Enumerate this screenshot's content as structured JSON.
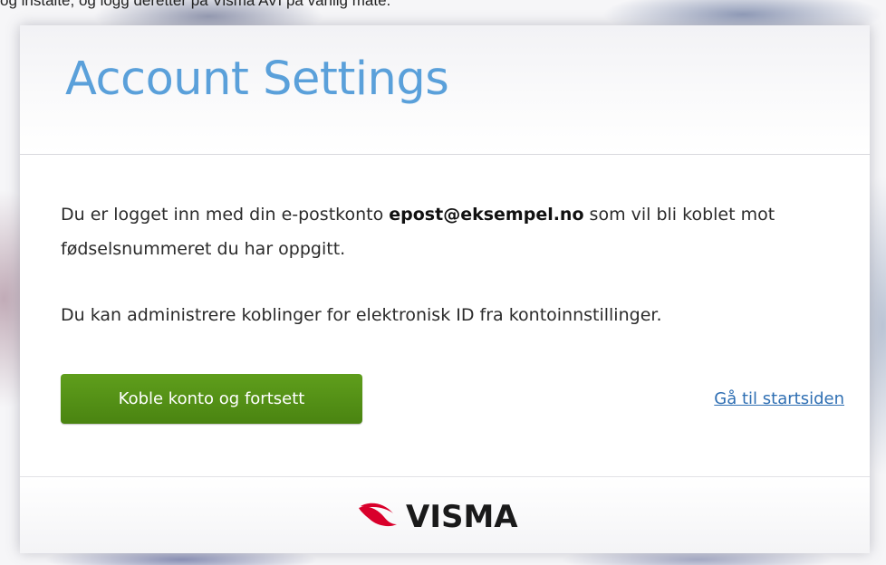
{
  "top_text": "og instalte, og logg deretter på Visma AVI på vanlig måte.",
  "card": {
    "title": "Account Settings",
    "body": {
      "line1_prefix": "Du er logget inn med din e-postkonto ",
      "email": "epost@eksempel.no",
      "line1_suffix": " som vil bli koblet mot fødselsnummeret du har oppgitt.",
      "line2": "Du kan administrere koblinger for elektronisk ID fra kontoinnstillinger."
    },
    "primary_button_label": "Koble konto og fortsett",
    "home_link_label": "Gå til startsiden",
    "footer": {
      "logo_text": "VISMA",
      "logo_color": "#d9002b"
    }
  },
  "colors": {
    "title": "#5aa0da",
    "button": "#4f8a14",
    "link": "#2f6fb3"
  }
}
